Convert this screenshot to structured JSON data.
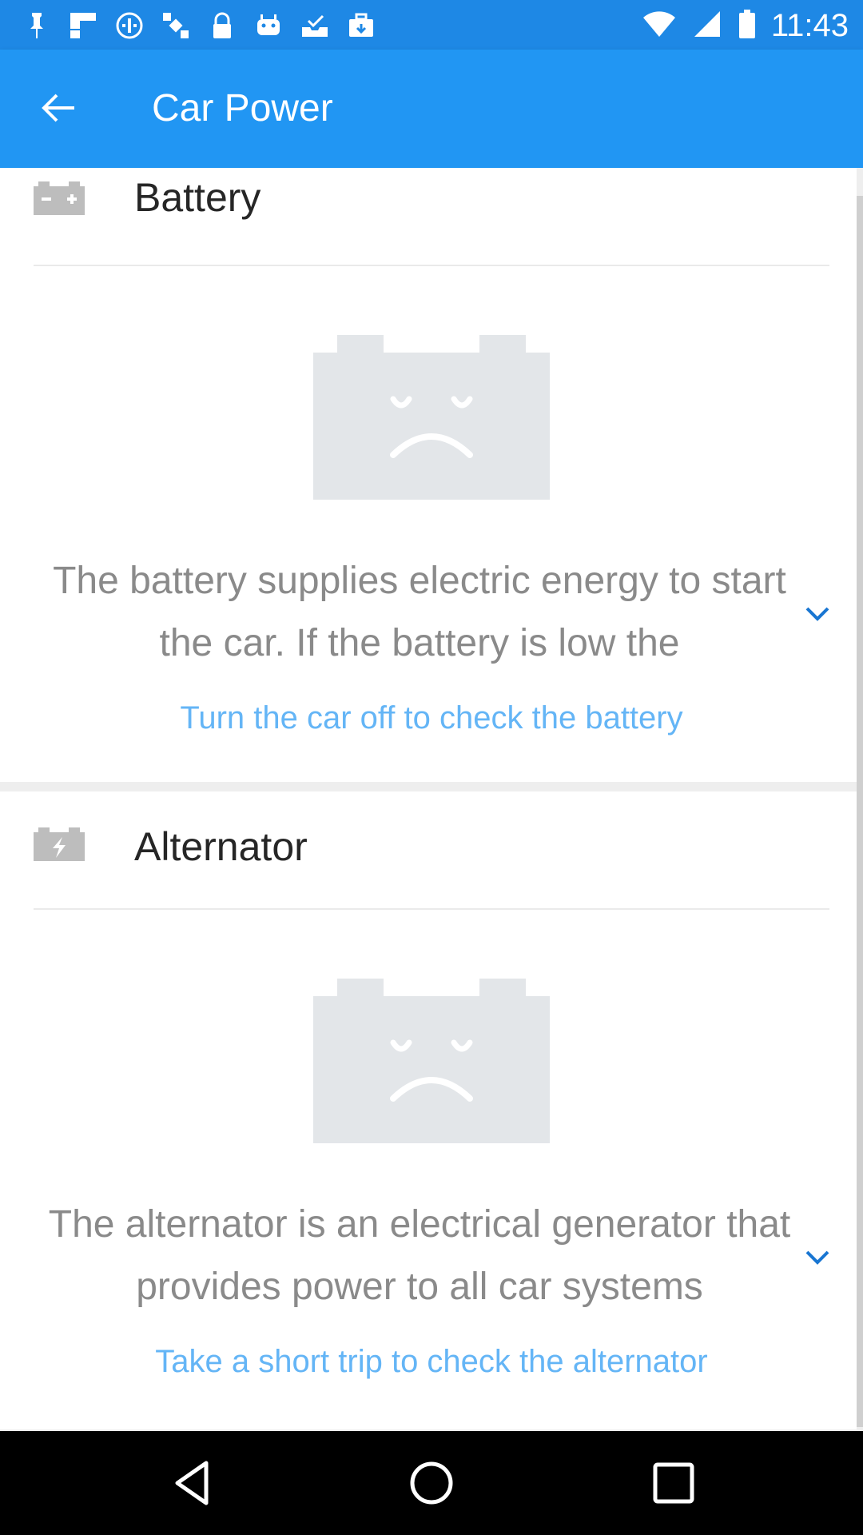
{
  "status_bar": {
    "time": "11:43",
    "icons": [
      "pin-icon",
      "flipboard-icon",
      "fake-gps-icon",
      "satellite-icon",
      "lock-icon",
      "android-icon",
      "inbox-check-icon",
      "work-bag-icon"
    ],
    "right_icons": [
      "wifi-icon",
      "signal-icon",
      "battery-icon"
    ]
  },
  "app_bar": {
    "title": "Car Power",
    "back_icon": "arrow-left-icon",
    "color": "#2196f3"
  },
  "cards": [
    {
      "title": "Battery",
      "icon": "battery-plus-minus-icon",
      "illustration": "sad-battery-icon",
      "description": "The battery supplies electric energy to start the car. If the battery is low the",
      "expand_icon": "chevron-down-icon",
      "hint": "Turn the car off to check the battery"
    },
    {
      "title": "Alternator",
      "icon": "battery-bolt-icon",
      "illustration": "sad-battery-icon",
      "description": "The alternator is an electrical generator that provides power to all car systems",
      "expand_icon": "chevron-down-icon",
      "hint": "Take a short trip to check the alternator"
    }
  ],
  "nav_bar": {
    "buttons": [
      "back-triangle-icon",
      "home-circle-icon",
      "recents-square-icon"
    ]
  },
  "colors": {
    "accent": "#2196f3",
    "link": "#64b5f6",
    "status": "#1e88e5"
  }
}
